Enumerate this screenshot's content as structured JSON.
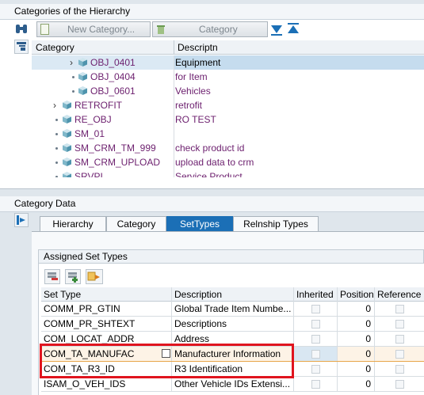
{
  "hierarchy_panel": {
    "title": "Categories of the Hierarchy",
    "toolbar": {
      "new_category_label": "New Category...",
      "category_label": "Category"
    },
    "columns": [
      "Category",
      "Descriptn"
    ],
    "rows": [
      {
        "code": "OBJ_0401",
        "desc": "Equipment",
        "selected": true,
        "expandable": true,
        "level": 2
      },
      {
        "code": "OBJ_0404",
        "desc": "for Item",
        "level": 2
      },
      {
        "code": "OBJ_0601",
        "desc": "Vehicles",
        "level": 2
      },
      {
        "code": "RETROFIT",
        "desc": "retrofit",
        "expandable": true,
        "level": 1
      },
      {
        "code": "RE_OBJ",
        "desc": "RO TEST",
        "level": 1
      },
      {
        "code": "SM_01",
        "desc": "",
        "level": 1
      },
      {
        "code": "SM_CRM_TM_999",
        "desc": "check product id",
        "level": 1
      },
      {
        "code": "SM_CRM_UPLOAD",
        "desc": "upload data to crm",
        "level": 1
      },
      {
        "code": "SRVPI",
        "desc": "Service Product",
        "level": 1
      }
    ]
  },
  "category_data": {
    "title": "Category Data",
    "tabs": [
      "Hierarchy",
      "Category",
      "SetTypes",
      "Relnship Types"
    ],
    "active_tab": "SetTypes",
    "assigned": {
      "title": "Assigned Set Types",
      "columns": [
        "Set Type",
        "Description",
        "Inherited",
        "Position",
        "Reference"
      ],
      "rows": [
        {
          "set_type": "COMM_PR_GTIN",
          "description": "Global Trade Item Numbe...",
          "position": "0"
        },
        {
          "set_type": "COMM_PR_SHTEXT",
          "description": "Descriptions",
          "position": "0"
        },
        {
          "set_type": "COM_LOCAT_ADDR",
          "description": "Address",
          "position": "0"
        },
        {
          "set_type": "COM_TA_MANUFAC",
          "description": "Manufacturer Information",
          "position": "0",
          "highlight": true
        },
        {
          "set_type": "COM_TA_R3_ID",
          "description": "R3 Identification",
          "position": "0",
          "highlight": true
        },
        {
          "set_type": "ISAM_O_VEH_IDS",
          "description": "Other Vehicle IDs Extensi...",
          "position": "0"
        }
      ]
    }
  },
  "colors": {
    "accent": "#1b6fb6",
    "highlight_border": "#e0141e",
    "code_text": "#6c1f6e"
  }
}
